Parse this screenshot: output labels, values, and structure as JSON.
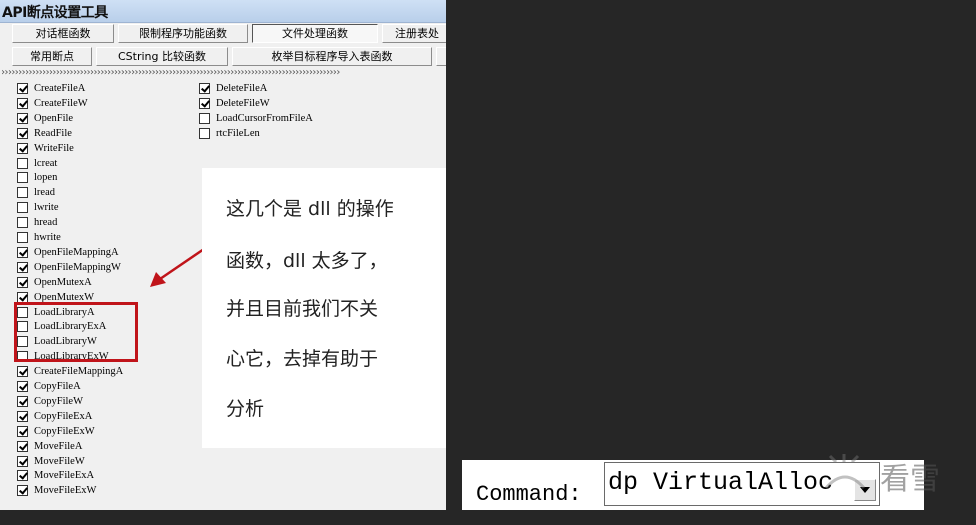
{
  "window": {
    "title": "API断点设置工具"
  },
  "tabs_row1": [
    "对话框函数",
    "限制程序功能函数",
    "文件处理函数",
    "注册表处"
  ],
  "tabs_row2": [
    "常用断点",
    "CString 比较函数",
    "枚举目标程序导入表函数",
    ""
  ],
  "chevrons": "›››››››››››››››››››››››››››››››››››››››››››››››››››››››››››››››››››››››››››››››››››››››››››››››››››",
  "left_column": [
    {
      "label": "CreateFileA",
      "checked": true
    },
    {
      "label": "CreateFileW",
      "checked": true
    },
    {
      "label": "OpenFile",
      "checked": true
    },
    {
      "label": "ReadFile",
      "checked": true
    },
    {
      "label": "WriteFile",
      "checked": true
    },
    {
      "label": "lcreat",
      "checked": false
    },
    {
      "label": "lopen",
      "checked": false
    },
    {
      "label": "lread",
      "checked": false
    },
    {
      "label": "lwrite",
      "checked": false
    },
    {
      "label": "hread",
      "checked": false
    },
    {
      "label": "hwrite",
      "checked": false
    },
    {
      "label": "OpenFileMappingA",
      "checked": true
    },
    {
      "label": "OpenFileMappingW",
      "checked": true
    },
    {
      "label": "OpenMutexA",
      "checked": true
    },
    {
      "label": "OpenMutexW",
      "checked": true
    },
    {
      "label": "LoadLibraryA",
      "checked": false
    },
    {
      "label": "LoadLibraryExA",
      "checked": false
    },
    {
      "label": "LoadLibraryW",
      "checked": false
    },
    {
      "label": "LoadLibraryExW",
      "checked": false
    },
    {
      "label": "CreateFileMappingA",
      "checked": true
    },
    {
      "label": "CopyFileA",
      "checked": true
    },
    {
      "label": "CopyFileW",
      "checked": true
    },
    {
      "label": "CopyFileExA",
      "checked": true
    },
    {
      "label": "CopyFileExW",
      "checked": true
    },
    {
      "label": "MoveFileA",
      "checked": true
    },
    {
      "label": "MoveFileW",
      "checked": true
    },
    {
      "label": "MoveFileExA",
      "checked": true
    },
    {
      "label": "MoveFileExW",
      "checked": true
    }
  ],
  "right_column": [
    {
      "label": "DeleteFileA",
      "checked": true
    },
    {
      "label": "DeleteFileW",
      "checked": true
    },
    {
      "label": "LoadCursorFromFileA",
      "checked": false
    },
    {
      "label": "rtcFileLen",
      "checked": false
    }
  ],
  "note_lines": [
    "这几个是 dll 的操作",
    "函数，dll 太多了，",
    "并且目前我们不关",
    "心它，去掉有助于",
    "分析"
  ],
  "command": {
    "label": "Command:",
    "value": "dp VirtualAlloc"
  },
  "watermark": "看雪",
  "colors": {
    "annotation_red": "#c0141a",
    "background": "#262626",
    "dialog": "#f0f0f0"
  }
}
